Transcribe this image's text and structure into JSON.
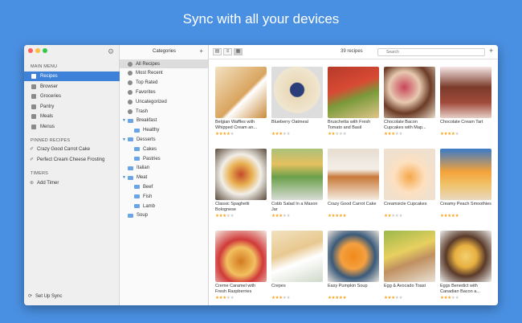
{
  "headline": "Sync with all your devices",
  "sidebar": {
    "main_menu_heading": "MAIN MENU",
    "items": [
      {
        "label": "Recipes",
        "active": true
      },
      {
        "label": "Browser"
      },
      {
        "label": "Groceries"
      },
      {
        "label": "Pantry"
      },
      {
        "label": "Meals"
      },
      {
        "label": "Menus"
      }
    ],
    "pinned_heading": "PINNED RECIPES",
    "pinned": [
      "Crazy Good Carrot Cake",
      "Perfect Cream Cheese Frosting"
    ],
    "timers_heading": "TIMERS",
    "add_timer": "Add Timer",
    "sync": "Set Up Sync"
  },
  "categories": {
    "title": "Categories",
    "items": [
      "All Recipes",
      "Most Recent",
      "Top Rated",
      "Favorites",
      "Uncategorized",
      "Trash",
      "Breakfast",
      "Healthy",
      "Desserts",
      "Cakes",
      "Pastries",
      "Italian",
      "Meat",
      "Beef",
      "Fish",
      "Lamb",
      "Soup"
    ]
  },
  "toolbar": {
    "count": "39 recipes",
    "search_placeholder": "Search"
  },
  "recipes": [
    {
      "title": "Belgian Waffles with Whipped Cream an...",
      "rating": 4
    },
    {
      "title": "Blueberry Oatmeal",
      "rating": 3
    },
    {
      "title": "Bruschetta with Fresh Tomato and Basil",
      "rating": 2
    },
    {
      "title": "Chocolate Bacon Cupcakes with Map...",
      "rating": 3
    },
    {
      "title": "Chocolate Cream Tart",
      "rating": 4
    },
    {
      "title": "Classic Spaghetti Bolognese",
      "rating": 3
    },
    {
      "title": "Cobb Salad In a Mason Jar",
      "rating": 3
    },
    {
      "title": "Crazy Good Carrot Cake",
      "rating": 5
    },
    {
      "title": "Creamsicle Cupcakes",
      "rating": 2
    },
    {
      "title": "Creamy Peach Smoothies",
      "rating": 5
    },
    {
      "title": "Creme Caramel with Fresh Raspberries",
      "rating": 3
    },
    {
      "title": "Crepes",
      "rating": 3
    },
    {
      "title": "Easy Pumpkin Soup",
      "rating": 5
    },
    {
      "title": "Egg & Avocado Toast",
      "rating": 3
    },
    {
      "title": "Eggs Benedict with Canadian Bacon a...",
      "rating": 3
    }
  ],
  "colors": {
    "background": "#4a90e2",
    "accent": "#3d82d8",
    "star": "#f5a623"
  }
}
